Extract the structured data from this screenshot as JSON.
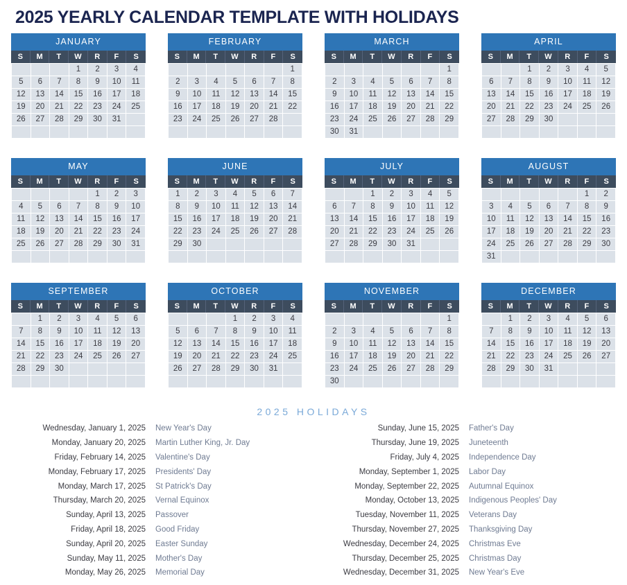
{
  "title": "2025 YEARLY CALENDAR TEMPLATE WITH HOLIDAYS",
  "colors": {
    "title": "#1b2550",
    "month_header": "#2e75b6",
    "weekday_header": "#3d4c5e",
    "day_cell": "#dbe1e8",
    "holidays_title": "#7aa9d8",
    "holiday_date": "#3b3b42",
    "holiday_name": "#6f7b92"
  },
  "weekdays": [
    "S",
    "M",
    "T",
    "W",
    "R",
    "F",
    "S"
  ],
  "months": [
    {
      "name": "JANUARY",
      "cells": [
        "",
        "",
        "",
        "1",
        "2",
        "3",
        "4",
        "5",
        "6",
        "7",
        "8",
        "9",
        "10",
        "11",
        "12",
        "13",
        "14",
        "15",
        "16",
        "17",
        "18",
        "19",
        "20",
        "21",
        "22",
        "23",
        "24",
        "25",
        "26",
        "27",
        "28",
        "29",
        "30",
        "31",
        "",
        "",
        "",
        "",
        "",
        "",
        "",
        ""
      ]
    },
    {
      "name": "FEBRUARY",
      "cells": [
        "",
        "",
        "",
        "",
        "",
        "",
        "1",
        "2",
        "3",
        "4",
        "5",
        "6",
        "7",
        "8",
        "9",
        "10",
        "11",
        "12",
        "13",
        "14",
        "15",
        "16",
        "17",
        "18",
        "19",
        "20",
        "21",
        "22",
        "23",
        "24",
        "25",
        "26",
        "27",
        "28",
        "",
        "",
        "",
        "",
        "",
        "",
        "",
        ""
      ]
    },
    {
      "name": "MARCH",
      "cells": [
        "",
        "",
        "",
        "",
        "",
        "",
        "1",
        "2",
        "3",
        "4",
        "5",
        "6",
        "7",
        "8",
        "9",
        "10",
        "11",
        "12",
        "13",
        "14",
        "15",
        "16",
        "17",
        "18",
        "19",
        "20",
        "21",
        "22",
        "23",
        "24",
        "25",
        "26",
        "27",
        "28",
        "29",
        "30",
        "31",
        "",
        "",
        "",
        "",
        ""
      ]
    },
    {
      "name": "APRIL",
      "cells": [
        "",
        "",
        "1",
        "2",
        "3",
        "4",
        "5",
        "6",
        "7",
        "8",
        "9",
        "10",
        "11",
        "12",
        "13",
        "14",
        "15",
        "16",
        "17",
        "18",
        "19",
        "20",
        "21",
        "22",
        "23",
        "24",
        "25",
        "26",
        "27",
        "28",
        "29",
        "30",
        "",
        "",
        "",
        "",
        "",
        "",
        "",
        "",
        "",
        ""
      ]
    },
    {
      "name": "MAY",
      "cells": [
        "",
        "",
        "",
        "",
        "1",
        "2",
        "3",
        "4",
        "5",
        "6",
        "7",
        "8",
        "9",
        "10",
        "11",
        "12",
        "13",
        "14",
        "15",
        "16",
        "17",
        "18",
        "19",
        "20",
        "21",
        "22",
        "23",
        "24",
        "25",
        "26",
        "27",
        "28",
        "29",
        "30",
        "31",
        "",
        "",
        "",
        "",
        "",
        "",
        ""
      ]
    },
    {
      "name": "JUNE",
      "cells": [
        "1",
        "2",
        "3",
        "4",
        "5",
        "6",
        "7",
        "8",
        "9",
        "10",
        "11",
        "12",
        "13",
        "14",
        "15",
        "16",
        "17",
        "18",
        "19",
        "20",
        "21",
        "22",
        "23",
        "24",
        "25",
        "26",
        "27",
        "28",
        "29",
        "30",
        "",
        "",
        "",
        "",
        "",
        "",
        "",
        "",
        "",
        "",
        "",
        ""
      ]
    },
    {
      "name": "JULY",
      "cells": [
        "",
        "",
        "1",
        "2",
        "3",
        "4",
        "5",
        "6",
        "7",
        "8",
        "9",
        "10",
        "11",
        "12",
        "13",
        "14",
        "15",
        "16",
        "17",
        "18",
        "19",
        "20",
        "21",
        "22",
        "23",
        "24",
        "25",
        "26",
        "27",
        "28",
        "29",
        "30",
        "31",
        "",
        "",
        "",
        "",
        "",
        "",
        "",
        "",
        ""
      ]
    },
    {
      "name": "AUGUST",
      "cells": [
        "",
        "",
        "",
        "",
        "",
        "1",
        "2",
        "3",
        "4",
        "5",
        "6",
        "7",
        "8",
        "9",
        "10",
        "11",
        "12",
        "13",
        "14",
        "15",
        "16",
        "17",
        "18",
        "19",
        "20",
        "21",
        "22",
        "23",
        "24",
        "25",
        "26",
        "27",
        "28",
        "29",
        "30",
        "31",
        "",
        "",
        "",
        "",
        "",
        ""
      ]
    },
    {
      "name": "SEPTEMBER",
      "cells": [
        "",
        "1",
        "2",
        "3",
        "4",
        "5",
        "6",
        "7",
        "8",
        "9",
        "10",
        "11",
        "12",
        "13",
        "14",
        "15",
        "16",
        "17",
        "18",
        "19",
        "20",
        "21",
        "22",
        "23",
        "24",
        "25",
        "26",
        "27",
        "28",
        "29",
        "30",
        "",
        "",
        "",
        "",
        "",
        "",
        "",
        "",
        "",
        "",
        ""
      ]
    },
    {
      "name": "OCTOBER",
      "cells": [
        "",
        "",
        "",
        "1",
        "2",
        "3",
        "4",
        "5",
        "6",
        "7",
        "8",
        "9",
        "10",
        "11",
        "12",
        "13",
        "14",
        "15",
        "16",
        "17",
        "18",
        "19",
        "20",
        "21",
        "22",
        "23",
        "24",
        "25",
        "26",
        "27",
        "28",
        "29",
        "30",
        "31",
        "",
        "",
        "",
        "",
        "",
        "",
        "",
        ""
      ]
    },
    {
      "name": "NOVEMBER",
      "cells": [
        "",
        "",
        "",
        "",
        "",
        "",
        "1",
        "2",
        "3",
        "4",
        "5",
        "6",
        "7",
        "8",
        "9",
        "10",
        "11",
        "12",
        "13",
        "14",
        "15",
        "16",
        "17",
        "18",
        "19",
        "20",
        "21",
        "22",
        "23",
        "24",
        "25",
        "26",
        "27",
        "28",
        "29",
        "30",
        "",
        "",
        "",
        "",
        "",
        ""
      ]
    },
    {
      "name": "DECEMBER",
      "cells": [
        "",
        "1",
        "2",
        "3",
        "4",
        "5",
        "6",
        "7",
        "8",
        "9",
        "10",
        "11",
        "12",
        "13",
        "14",
        "15",
        "16",
        "17",
        "18",
        "19",
        "20",
        "21",
        "22",
        "23",
        "24",
        "25",
        "26",
        "27",
        "28",
        "29",
        "30",
        "31",
        "",
        "",
        "",
        "",
        "",
        "",
        "",
        "",
        "",
        ""
      ]
    }
  ],
  "holidays_title": "2025 HOLIDAYS",
  "holidays_left": [
    {
      "date": "Wednesday, January 1, 2025",
      "name": "New Year's Day"
    },
    {
      "date": "Monday, January 20, 2025",
      "name": "Martin Luther King, Jr. Day"
    },
    {
      "date": "Friday, February 14, 2025",
      "name": "Valentine's Day"
    },
    {
      "date": "Monday, February 17, 2025",
      "name": "Presidents' Day"
    },
    {
      "date": "Monday, March 17, 2025",
      "name": "St Patrick's Day"
    },
    {
      "date": "Thursday, March 20, 2025",
      "name": "Vernal Equinox"
    },
    {
      "date": "Sunday, April 13, 2025",
      "name": "Passover"
    },
    {
      "date": "Friday, April 18, 2025",
      "name": "Good Friday"
    },
    {
      "date": "Sunday, April 20, 2025",
      "name": "Easter Sunday"
    },
    {
      "date": "Sunday, May 11, 2025",
      "name": "Mother's Day"
    },
    {
      "date": "Monday, May 26, 2025",
      "name": "Memorial Day"
    }
  ],
  "holidays_right": [
    {
      "date": "Sunday, June 15, 2025",
      "name": "Father's Day"
    },
    {
      "date": "Thursday, June 19, 2025",
      "name": "Juneteenth"
    },
    {
      "date": "Friday, July 4, 2025",
      "name": "Independence Day"
    },
    {
      "date": "Monday, September 1, 2025",
      "name": "Labor Day"
    },
    {
      "date": "Monday, September 22, 2025",
      "name": "Autumnal Equinox"
    },
    {
      "date": "Monday, October 13, 2025",
      "name": "Indigenous Peoples' Day"
    },
    {
      "date": "Tuesday, November 11, 2025",
      "name": "Veterans Day"
    },
    {
      "date": "Thursday, November 27, 2025",
      "name": "Thanksgiving Day"
    },
    {
      "date": "Wednesday, December 24, 2025",
      "name": "Christmas Eve"
    },
    {
      "date": "Thursday, December 25, 2025",
      "name": "Christmas Day"
    },
    {
      "date": "Wednesday, December 31, 2025",
      "name": "New Year's Eve"
    }
  ]
}
